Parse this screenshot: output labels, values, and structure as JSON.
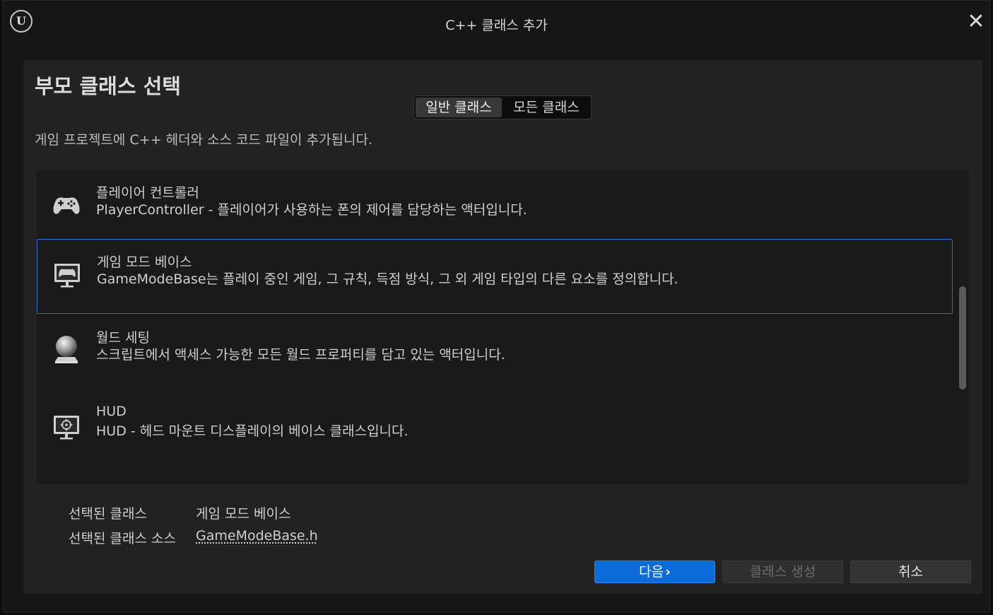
{
  "window": {
    "title": "C++ 클래스 추가",
    "logo_text": "U",
    "close_glyph": "✕"
  },
  "header": {
    "heading": "부모 클래스 선택",
    "tabs": [
      {
        "label": "일반 클래스",
        "active": true
      },
      {
        "label": "모든 클래스",
        "active": false
      }
    ],
    "description": "게임 프로젝트에 C++ 헤더와 소스 코드 파일이 추가됩니다."
  },
  "classes": [
    {
      "icon": "gamepad-icon",
      "name": "플레이어 컨트롤러",
      "description": "PlayerController - 플레이어가 사용하는 폰의 제어를 담당하는 액터입니다.",
      "selected": false
    },
    {
      "icon": "game-mode-monitor-icon",
      "name": "게임 모드 베이스",
      "description": "GameModeBase는 플레이 중인 게임, 그 규칙, 득점 방식, 그 외 게임 타입의 다른 요소를 정의합니다.",
      "selected": true
    },
    {
      "icon": "world-settings-sphere-icon",
      "name": "월드 세팅",
      "description": "스크립트에서 액세스 가능한 모든 월드 프로퍼티를 담고 있는 액터입니다.",
      "selected": false
    },
    {
      "icon": "hud-monitor-icon",
      "name": "HUD",
      "description": "HUD - 헤드 마운트 디스플레이의 베이스 클래스입니다.",
      "selected": false
    }
  ],
  "selection": {
    "class_label": "선택된 클래스",
    "class_value": "게임 모드 베이스",
    "source_label": "선택된 클래스 소스",
    "source_value": "GameModeBase.h"
  },
  "buttons": {
    "next": "다음",
    "create": "클래스 생성",
    "cancel": "취소"
  },
  "colors": {
    "accent": "#0a6bd9",
    "selection_border": "#1f6fd8"
  }
}
